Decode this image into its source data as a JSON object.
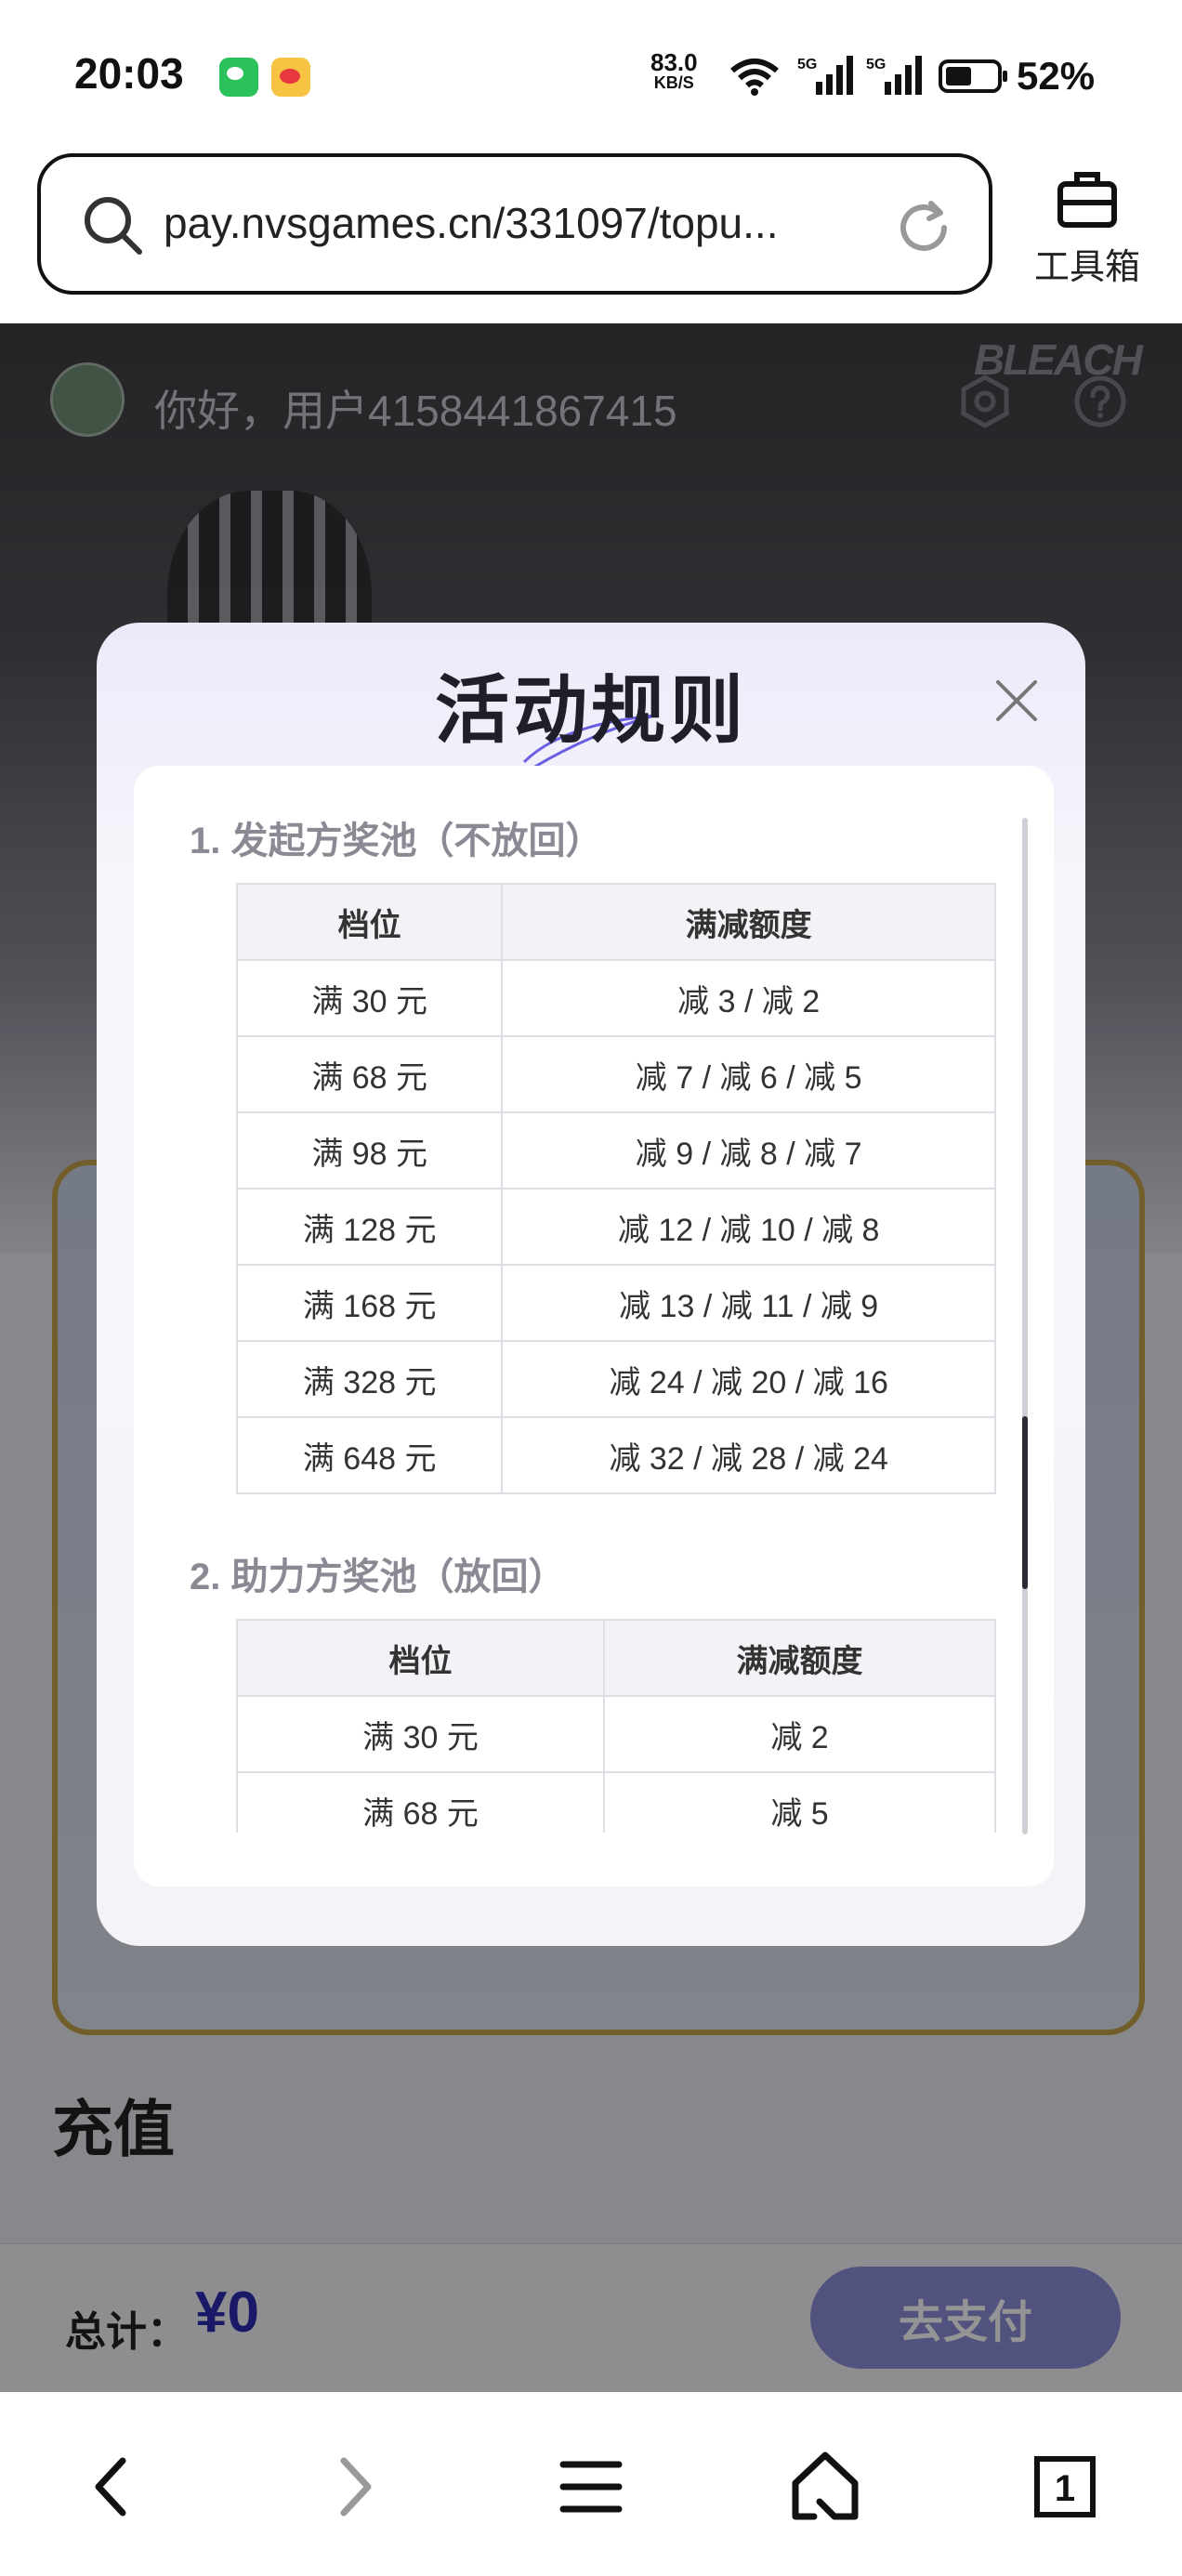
{
  "status_bar": {
    "time": "20:03",
    "net_speed_value": "83.0",
    "net_speed_unit": "KB/S",
    "signal_label_1": "5G",
    "signal_label_2": "5G",
    "battery_percent": "52%",
    "battery_level": 0.52
  },
  "browser": {
    "url": "pay.nvsgames.cn/331097/topu...",
    "toolbox_label": "工具箱"
  },
  "page": {
    "greeting": "你好，用户4158441867415",
    "brand_logo": "BLEACH",
    "recharge_title": "充值",
    "total_label": "总计：",
    "total_amount": "¥0",
    "pay_button": "去支付"
  },
  "modal": {
    "title": "活动规则",
    "sections": [
      {
        "title": "1. 发起方奖池（不放回）",
        "headers": [
          "档位",
          "满减额度"
        ],
        "rows": [
          [
            "满 30 元",
            "减 3 / 减 2"
          ],
          [
            "满 68 元",
            "减 7 / 减 6 / 减 5"
          ],
          [
            "满 98 元",
            "减 9 / 减 8 / 减 7"
          ],
          [
            "满 128 元",
            "减 12 / 减 10 / 减 8"
          ],
          [
            "满 168 元",
            "减 13 / 减 11 / 减 9"
          ],
          [
            "满 328 元",
            "减 24 / 减 20 / 减 16"
          ],
          [
            "满 648 元",
            "减 32 / 减 28 / 减 24"
          ]
        ]
      },
      {
        "title": "2. 助力方奖池（放回）",
        "headers": [
          "档位",
          "满减额度"
        ],
        "rows": [
          [
            "满 30 元",
            "减 2"
          ],
          [
            "满 68 元",
            "减 5"
          ]
        ]
      }
    ]
  },
  "nav": {
    "tabs_count": "1"
  },
  "colors": {
    "accent": "#2e2bb3",
    "pay_button": "#8c8ed9",
    "card_border": "#c5a24a"
  },
  "icons": [
    "wechat-icon",
    "weibo-icon",
    "wifi-icon",
    "signal-icon",
    "battery-icon",
    "search-icon",
    "reload-icon",
    "toolbox-icon",
    "settings-icon",
    "help-icon",
    "close-icon",
    "back-icon",
    "forward-icon",
    "menu-icon",
    "home-icon",
    "tabs-icon"
  ]
}
